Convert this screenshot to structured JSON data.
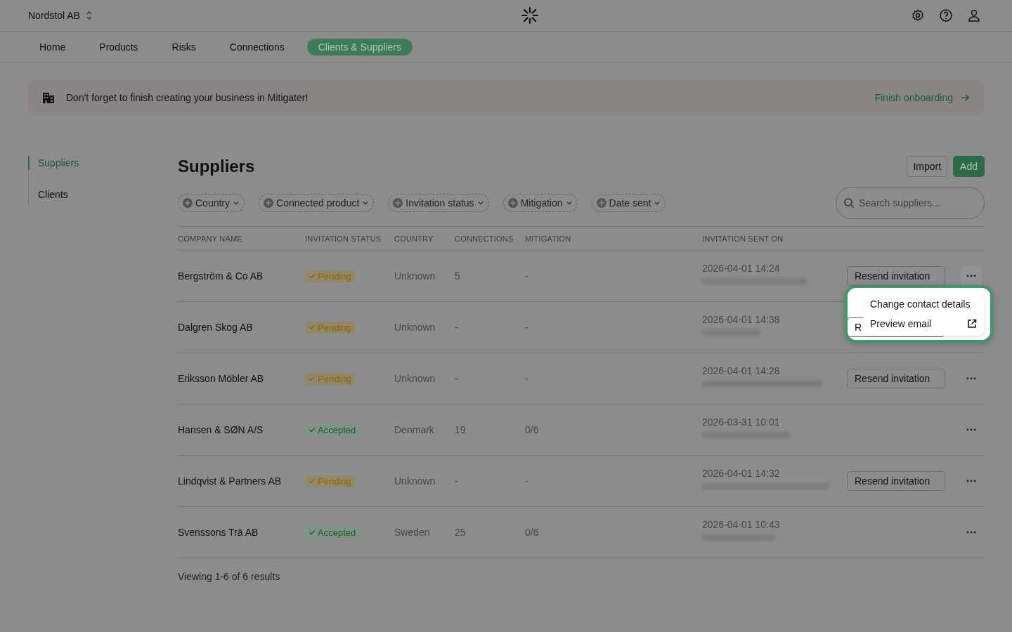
{
  "org": {
    "name": "Nordstol AB"
  },
  "nav": [
    {
      "label": "Home",
      "selected": false
    },
    {
      "label": "Products",
      "selected": false
    },
    {
      "label": "Risks",
      "selected": false
    },
    {
      "label": "Connections",
      "selected": false
    },
    {
      "label": "Clients & Suppliers",
      "selected": true
    }
  ],
  "banner": {
    "text": "Don't forget to finish creating your business in Mitigater!",
    "link": "Finish onboarding"
  },
  "sidebar": {
    "items": [
      {
        "label": "Suppliers",
        "selected": true
      },
      {
        "label": "Clients",
        "selected": false
      }
    ]
  },
  "title": "Suppliers",
  "buttons": {
    "import": "Import",
    "add": "Add"
  },
  "filters": [
    "Country",
    "Connected product",
    "Invitation status",
    "Mitigation",
    "Date sent"
  ],
  "search": {
    "placeholder": "Search suppliers..."
  },
  "table": {
    "columns": [
      "COMPANY NAME",
      "INVITATION STATUS",
      "COUNTRY",
      "CONNECTIONS",
      "MITIGATION",
      "INVITATION SENT ON"
    ],
    "rows": [
      {
        "company": "Bergström & Co AB",
        "status": "Pending",
        "kind": "pending",
        "country": "Unknown",
        "connections": "5",
        "mitigation": "-",
        "sent": "2026-04-01 14:24",
        "resend": "Resend invitation",
        "menu_open": true
      },
      {
        "company": "Dalgren Skog AB",
        "status": "Pending",
        "kind": "pending",
        "country": "Unknown",
        "connections": "-",
        "mitigation": "-",
        "sent": "2026-04-01 14:38",
        "resend": "R",
        "menu_open": false
      },
      {
        "company": "Eriksson Möbler AB",
        "status": "Pending",
        "kind": "pending",
        "country": "Unknown",
        "connections": "-",
        "mitigation": "-",
        "sent": "2026-04-01 14:28",
        "resend": "Resend invitation",
        "menu_open": false
      },
      {
        "company": "Hansen & SØN A/S",
        "status": "Accepted",
        "kind": "accepted",
        "country": "Denmark",
        "connections": "19",
        "mitigation": "0/6",
        "sent": "2026-03-31 10:01",
        "menu_open": false
      },
      {
        "company": "Lindqvist & Partners AB",
        "status": "Pending",
        "kind": "pending",
        "country": "Unknown",
        "connections": "-",
        "mitigation": "-",
        "sent": "2026-04-01 14:32",
        "resend": "Resend invitation",
        "menu_open": false
      },
      {
        "company": "Svenssons Trä AB",
        "status": "Accepted",
        "kind": "accepted",
        "country": "Sweden",
        "connections": "25",
        "mitigation": "0/6",
        "sent": "2026-04-01 10:43",
        "menu_open": false
      }
    ]
  },
  "footer": "Viewing 1-6 of 6 results",
  "menu": {
    "items": [
      "Change contact details",
      "Preview email"
    ]
  }
}
